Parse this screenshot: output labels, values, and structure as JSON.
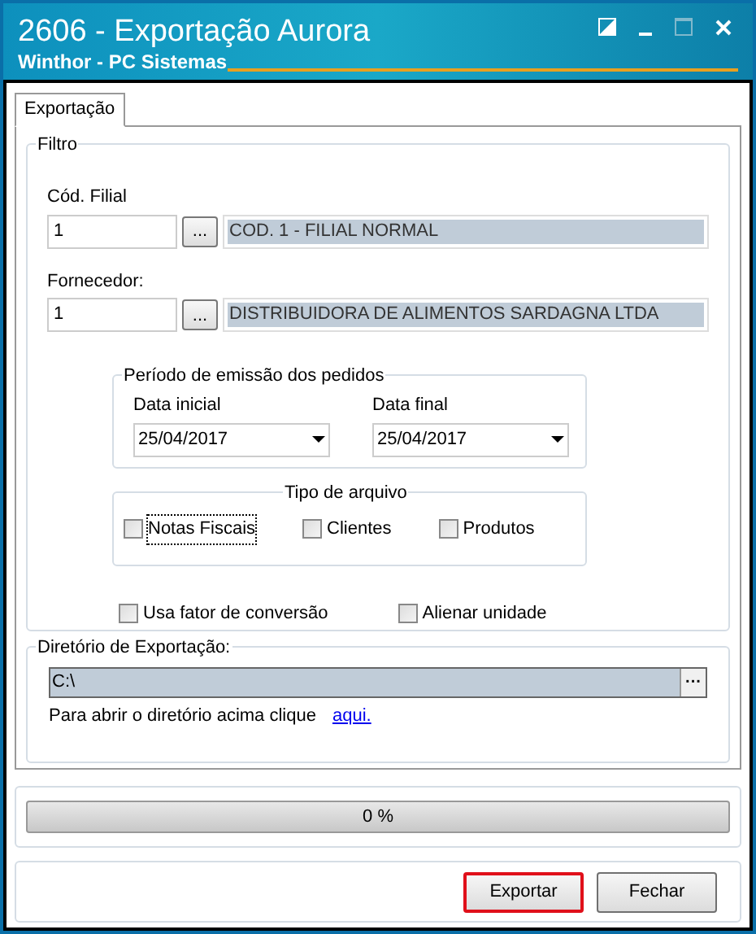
{
  "window": {
    "title": "2606 - Exportação Aurora",
    "subtitle": "Winthor - PC Sistemas"
  },
  "tabs": [
    {
      "label": "Exportação",
      "selected": true
    }
  ],
  "filtro": {
    "title": "Filtro",
    "filial": {
      "label": "Cód. Filial",
      "value": "1",
      "button": "...",
      "description": "COD. 1 - FILIAL NORMAL"
    },
    "fornecedor": {
      "label": "Fornecedor:",
      "value": "1",
      "button": "...",
      "description": "DISTRIBUIDORA DE ALIMENTOS SARDAGNA LTDA"
    },
    "periodo": {
      "title": "Período de emissão dos pedidos",
      "fields": [
        {
          "label": "Data inicial",
          "value": "25/04/2017"
        },
        {
          "label": "Data final",
          "value": "25/04/2017"
        }
      ]
    },
    "tipo": {
      "title": "Tipo de arquivo",
      "options": [
        {
          "label": "Notas Fiscais",
          "checked": false,
          "focused": true
        },
        {
          "label": "Clientes",
          "checked": false,
          "focused": false
        },
        {
          "label": "Produtos",
          "checked": false,
          "focused": false
        }
      ]
    },
    "options": [
      {
        "label": "Usa fator de conversão",
        "checked": false
      },
      {
        "label": "Alienar unidade",
        "checked": false
      }
    ]
  },
  "diretorio": {
    "title": "Diretório de Exportação:",
    "value": "C:\\",
    "button": "···",
    "hint": "Para abrir o diretório acima clique",
    "link": "aqui."
  },
  "progress": {
    "level": 0,
    "reading": "0 %"
  },
  "buttons": [
    {
      "label": "Exportar",
      "highlighted": true
    },
    {
      "label": "Fechar",
      "highlighted": false
    }
  ]
}
